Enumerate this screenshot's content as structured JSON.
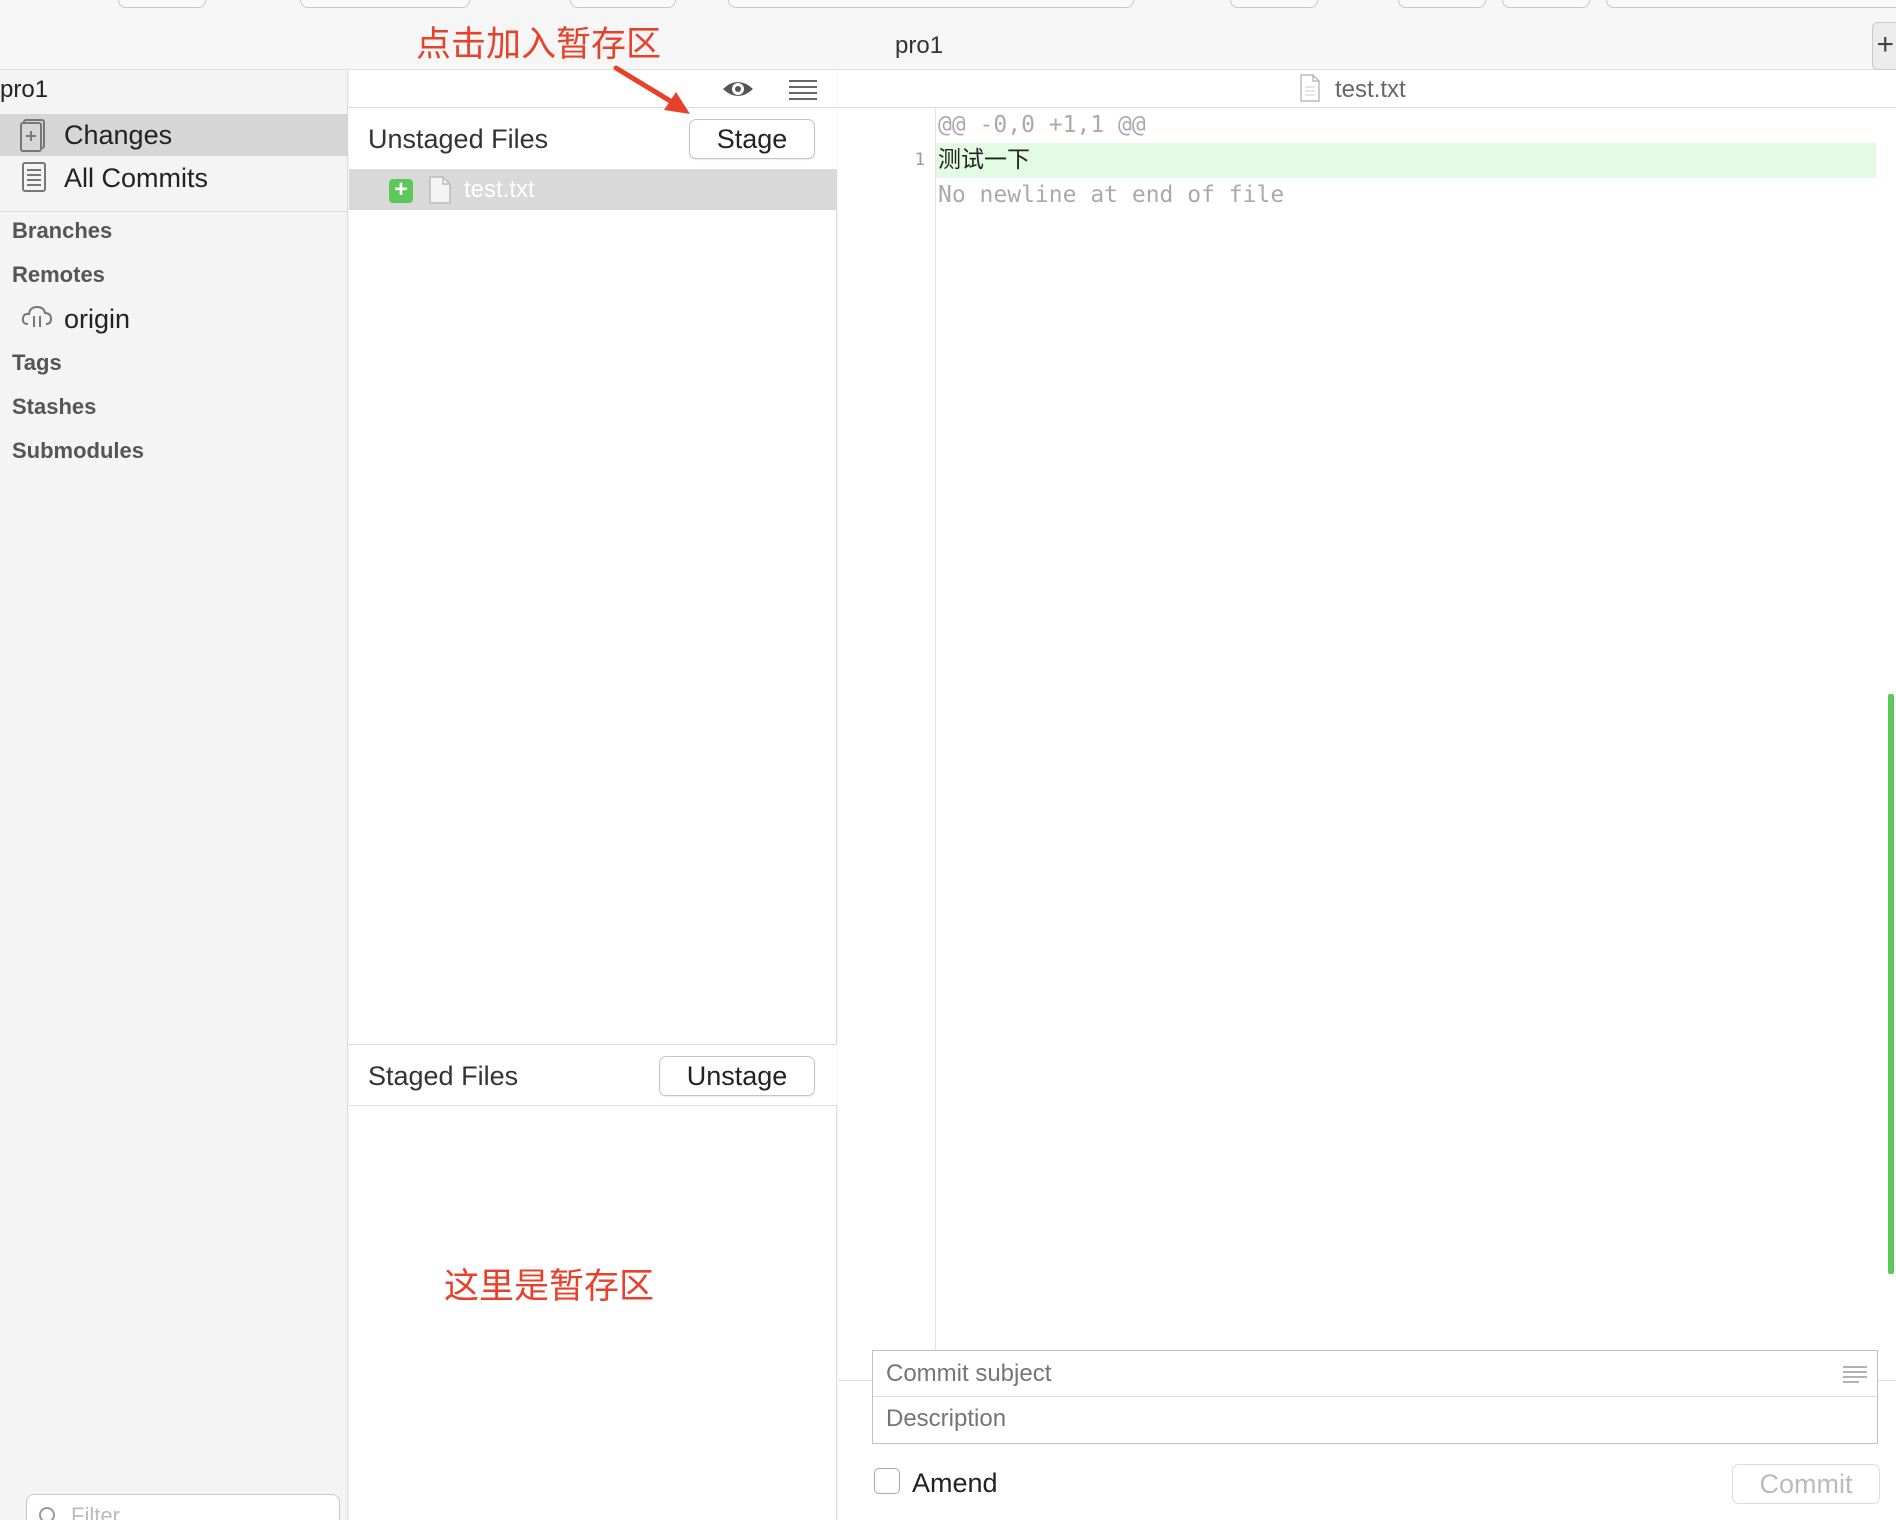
{
  "window": {
    "title": "pro1",
    "add_label": "+"
  },
  "sidebar": {
    "repo_name": "pro1",
    "items": [
      {
        "label": "Changes",
        "selected": true,
        "icon": "changes-icon"
      },
      {
        "label": "All Commits",
        "selected": false,
        "icon": "commits-icon"
      }
    ],
    "sections": {
      "branches": "Branches",
      "remotes": "Remotes",
      "tags": "Tags",
      "stashes": "Stashes",
      "submodules": "Submodules"
    },
    "remote_items": [
      {
        "label": "origin",
        "icon": "cloud-icon"
      }
    ],
    "filter_placeholder": "Filter"
  },
  "changes": {
    "unstaged": {
      "title": "Unstaged Files",
      "button": "Stage",
      "files": [
        {
          "name": "test.txt",
          "status": "added"
        }
      ]
    },
    "staged": {
      "title": "Staged Files",
      "button": "Unstage",
      "files": []
    }
  },
  "diff": {
    "file": "test.txt",
    "hunk_header": "@@ -0,0 +1,1 @@",
    "lines": [
      {
        "number": "1",
        "text": "测试一下",
        "type": "added"
      }
    ],
    "no_newline_note": "No newline at end of file"
  },
  "commit": {
    "subject_placeholder": "Commit subject",
    "description_placeholder": "Description",
    "amend_label": "Amend",
    "amend_checked": false,
    "button": "Commit"
  },
  "annotations": {
    "stage_hint": "点击加入暂存区",
    "staged_area_hint": "这里是暂存区"
  },
  "colors": {
    "annotation": "#e8412b",
    "added_line_bg": "#e3fbe3",
    "added_badge": "#5cc85a",
    "selection": "#d6d6d6"
  }
}
